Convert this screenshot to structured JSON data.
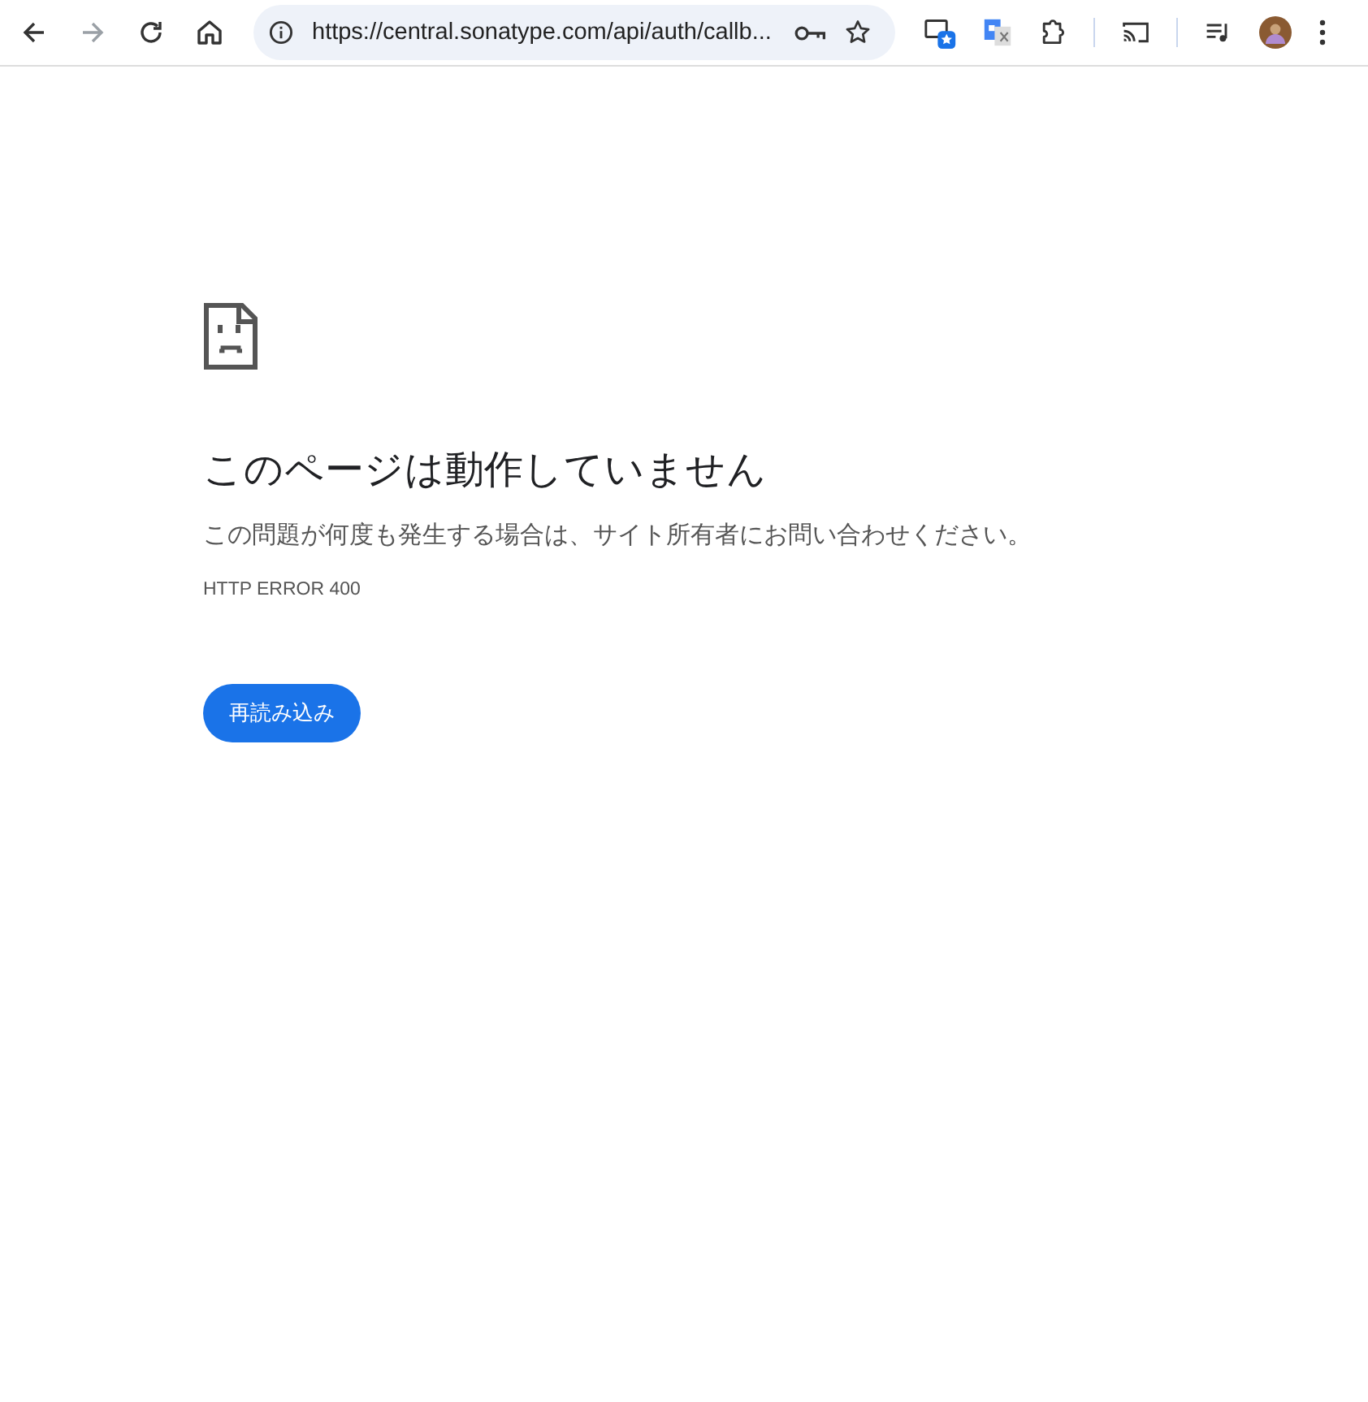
{
  "toolbar": {
    "nav": [
      {
        "kind": "back",
        "disabled": false
      },
      {
        "kind": "forward",
        "disabled": true
      },
      {
        "kind": "reload",
        "disabled": false
      },
      {
        "kind": "home",
        "disabled": false
      }
    ],
    "address": {
      "url": "https://central.sonatype.com/api/auth/callb..."
    }
  },
  "page": {
    "title": "このページは動作していません",
    "message": "この問題が何度も発生する場合は、サイト所有者にお問い合わせください。",
    "error_code": "HTTP ERROR 400",
    "button": "再読み込み"
  }
}
